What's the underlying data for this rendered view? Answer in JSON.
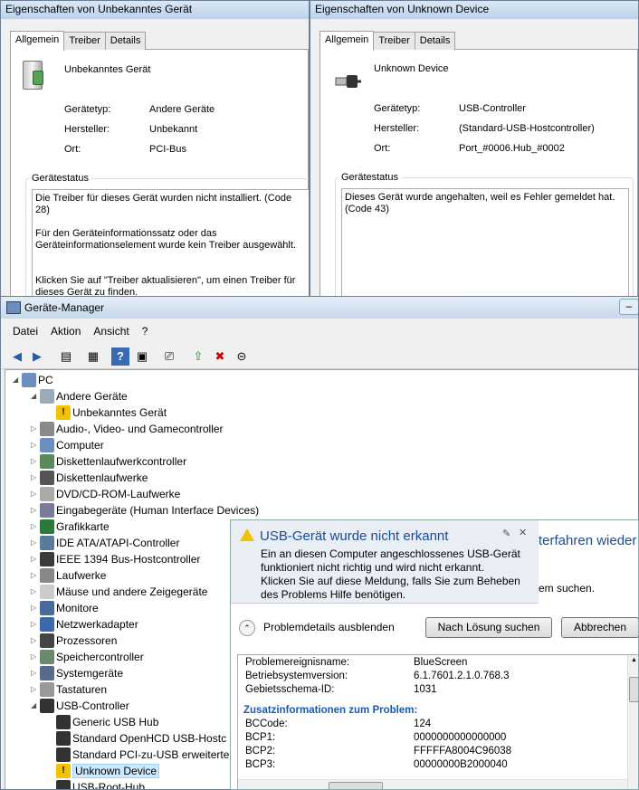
{
  "props_left": {
    "title": "Eigenschaften von Unbekanntes Gerät",
    "tabs": [
      "Allgemein",
      "Treiber",
      "Details"
    ],
    "device_name": "Unbekanntes Gerät",
    "fields": [
      {
        "label": "Gerätetyp:",
        "value": "Andere Geräte"
      },
      {
        "label": "Hersteller:",
        "value": "Unbekannt"
      },
      {
        "label": "Ort:",
        "value": "PCI-Bus"
      }
    ],
    "status_title": "Gerätestatus",
    "status_text": "Die Treiber für dieses Gerät wurden nicht installiert. (Code 28)\n\nFür den Geräteinformationssatz oder das Geräteinformationselement wurde kein Treiber ausgewählt.\n\n\nKlicken Sie auf \"Treiber aktualisieren\", um einen Treiber für dieses Gerät zu finden."
  },
  "props_right": {
    "title": "Eigenschaften von Unknown Device",
    "tabs": [
      "Allgemein",
      "Treiber",
      "Details"
    ],
    "device_name": "Unknown Device",
    "fields": [
      {
        "label": "Gerätetyp:",
        "value": "USB-Controller"
      },
      {
        "label": "Hersteller:",
        "value": "(Standard-USB-Hostcontroller)"
      },
      {
        "label": "Ort:",
        "value": "Port_#0006.Hub_#0002"
      }
    ],
    "status_title": "Gerätestatus",
    "status_text": "Dieses Gerät wurde angehalten, weil es Fehler gemeldet hat. (Code 43)"
  },
  "devmgr": {
    "title": "Geräte-Manager",
    "menu": [
      "Datei",
      "Aktion",
      "Ansicht",
      "?"
    ],
    "tree": [
      {
        "label": "PC",
        "level": 0,
        "exp": "◢",
        "icon": "computer-icon"
      },
      {
        "label": "Andere Geräte",
        "level": 1,
        "exp": "◢",
        "icon": "unknown-device-icon"
      },
      {
        "label": "Unbekanntes Gerät",
        "level": 2,
        "exp": "",
        "icon": "warning-device-icon"
      },
      {
        "label": "Audio-, Video- und Gamecontroller",
        "level": 1,
        "exp": "▷",
        "icon": "audio-icon"
      },
      {
        "label": "Computer",
        "level": 1,
        "exp": "▷",
        "icon": "computer-icon"
      },
      {
        "label": "Diskettenlaufwerkcontroller",
        "level": 1,
        "exp": "▷",
        "icon": "controller-icon"
      },
      {
        "label": "Diskettenlaufwerke",
        "level": 1,
        "exp": "▷",
        "icon": "floppy-icon"
      },
      {
        "label": "DVD/CD-ROM-Laufwerke",
        "level": 1,
        "exp": "▷",
        "icon": "dvd-icon"
      },
      {
        "label": "Eingabegeräte (Human Interface Devices)",
        "level": 1,
        "exp": "▷",
        "icon": "hid-icon"
      },
      {
        "label": "Grafikkarte",
        "level": 1,
        "exp": "▷",
        "icon": "display-adapter-icon"
      },
      {
        "label": "IDE ATA/ATAPI-Controller",
        "level": 1,
        "exp": "▷",
        "icon": "ide-icon"
      },
      {
        "label": "IEEE 1394 Bus-Hostcontroller",
        "level": 1,
        "exp": "▷",
        "icon": "firewire-icon"
      },
      {
        "label": "Laufwerke",
        "level": 1,
        "exp": "▷",
        "icon": "disk-icon"
      },
      {
        "label": "Mäuse und andere Zeigegeräte",
        "level": 1,
        "exp": "▷",
        "icon": "mouse-icon"
      },
      {
        "label": "Monitore",
        "level": 1,
        "exp": "▷",
        "icon": "monitor-icon"
      },
      {
        "label": "Netzwerkadapter",
        "level": 1,
        "exp": "▷",
        "icon": "network-icon"
      },
      {
        "label": "Prozessoren",
        "level": 1,
        "exp": "▷",
        "icon": "cpu-icon"
      },
      {
        "label": "Speichercontroller",
        "level": 1,
        "exp": "▷",
        "icon": "storage-icon"
      },
      {
        "label": "Systemgeräte",
        "level": 1,
        "exp": "▷",
        "icon": "system-icon"
      },
      {
        "label": "Tastaturen",
        "level": 1,
        "exp": "▷",
        "icon": "keyboard-icon"
      },
      {
        "label": "USB-Controller",
        "level": 1,
        "exp": "◢",
        "icon": "usb-icon"
      },
      {
        "label": "Generic USB Hub",
        "level": 2,
        "exp": "",
        "icon": "usb-plug-icon"
      },
      {
        "label": "Standard OpenHCD USB-Hostc",
        "level": 2,
        "exp": "",
        "icon": "usb-plug-icon"
      },
      {
        "label": "Standard PCI-zu-USB erweiterte",
        "level": 2,
        "exp": "",
        "icon": "usb-plug-icon"
      },
      {
        "label": "Unknown Device",
        "level": 2,
        "exp": "",
        "icon": "warning-usb-icon",
        "selected": true
      },
      {
        "label": "USB-Root-Hub",
        "level": 2,
        "exp": "",
        "icon": "usb-plug-icon"
      }
    ]
  },
  "popup": {
    "heading": "USB-Gerät wurde nicht erkannt",
    "body": "Ein an diesen Computer angeschlossenes USB-Gerät funktioniert nicht richtig und wird nicht erkannt.\nKlicken Sie auf diese Meldung, falls Sie zum Beheben des Problems Hilfe benötigen.",
    "behind_text_1": "terfahren wieder",
    "behind_text_2": "em suchen.",
    "details_toggle": "Problemdetails ausblenden",
    "btn_solution": "Nach Lösung suchen",
    "btn_cancel": "Abbrechen",
    "details": [
      {
        "k": "Problemereignisname:",
        "v": "BlueScreen"
      },
      {
        "k": "Betriebsystemversion:",
        "v": "6.1.7601.2.1.0.768.3"
      },
      {
        "k": "Gebietsschema-ID:",
        "v": "1031"
      }
    ],
    "extra_title": "Zusatzinformationen zum Problem:",
    "extra": [
      {
        "k": "BCCode:",
        "v": "124"
      },
      {
        "k": "BCP1:",
        "v": "0000000000000000"
      },
      {
        "k": "BCP2:",
        "v": "FFFFFA8004C96038"
      },
      {
        "k": "BCP3:",
        "v": "00000000B2000040"
      }
    ]
  }
}
